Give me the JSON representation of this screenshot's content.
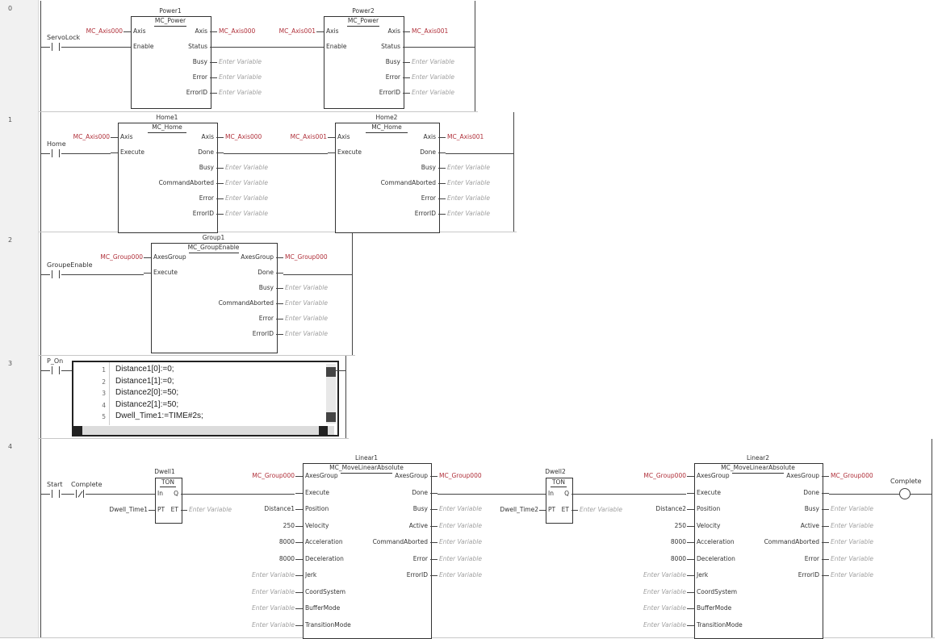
{
  "rungs": [
    {
      "number": "0",
      "contact": {
        "label": "ServoLock"
      },
      "blocks": [
        {
          "instance": "Power1",
          "type": "MC_Power",
          "axis_in": "MC_Axis000",
          "axis_out": "MC_Axis000",
          "inputs": [
            "Axis",
            "Enable"
          ],
          "outputs": [
            "Axis",
            "Status",
            "Busy",
            "Error",
            "ErrorID"
          ]
        },
        {
          "instance": "Power2",
          "type": "MC_Power",
          "axis_in": "MC_Axis001",
          "axis_out": "MC_Axis001",
          "inputs": [
            "Axis",
            "Enable"
          ],
          "outputs": [
            "Axis",
            "Status",
            "Busy",
            "Error",
            "ErrorID"
          ]
        }
      ]
    },
    {
      "number": "1",
      "contact": {
        "label": "Home"
      },
      "blocks": [
        {
          "instance": "Home1",
          "type": "MC_Home",
          "axis_in": "MC_Axis000",
          "axis_out": "MC_Axis000",
          "inputs": [
            "Axis",
            "Execute"
          ],
          "outputs": [
            "Axis",
            "Done",
            "Busy",
            "CommandAborted",
            "Error",
            "ErrorID"
          ]
        },
        {
          "instance": "Home2",
          "type": "MC_Home",
          "axis_in": "MC_Axis001",
          "axis_out": "MC_Axis001",
          "inputs": [
            "Axis",
            "Execute"
          ],
          "outputs": [
            "Axis",
            "Done",
            "Busy",
            "CommandAborted",
            "Error",
            "ErrorID"
          ]
        }
      ]
    },
    {
      "number": "2",
      "contact": {
        "label": "GroupeEnable"
      },
      "blocks": [
        {
          "instance": "Group1",
          "type": "MC_GroupEnable",
          "axis_in": "MC_Group000",
          "axis_out": "MC_Group000",
          "inputs": [
            "AxesGroup",
            "Execute"
          ],
          "outputs": [
            "AxesGroup",
            "Done",
            "Busy",
            "CommandAborted",
            "Error",
            "ErrorID"
          ]
        }
      ]
    },
    {
      "number": "3",
      "contact": {
        "label": "P_On"
      },
      "st_lines": [
        {
          "n": "1",
          "code": "Distance1[0]:=0;"
        },
        {
          "n": "2",
          "code": "Distance1[1]:=0;"
        },
        {
          "n": "3",
          "code": "Distance2[0]:=50;"
        },
        {
          "n": "4",
          "code": "Distance2[1]:=50;"
        },
        {
          "n": "5",
          "code": "Dwell_Time1:=TIME#2s;"
        }
      ]
    },
    {
      "number": "4",
      "contacts": [
        "Start",
        "Complete"
      ],
      "timers": [
        {
          "instance": "Dwell1",
          "type": "TON",
          "pin_in": "In",
          "pin_q": "Q",
          "pin_pt": "PT",
          "pin_et": "ET",
          "pt_value": "Dwell_Time1"
        },
        {
          "instance": "Dwell2",
          "type": "TON",
          "pin_in": "In",
          "pin_q": "Q",
          "pin_pt": "PT",
          "pin_et": "ET",
          "pt_value": "Dwell_Time2"
        }
      ],
      "moves": [
        {
          "instance": "Linear1",
          "type": "MC_MoveLinearAbsolute",
          "group_in": "MC_Group000",
          "group_out": "MC_Group000",
          "inputs": [
            "AxesGroup",
            "Execute",
            "Position",
            "Velocity",
            "Acceleration",
            "Deceleration",
            "Jerk",
            "CoordSystem",
            "BufferMode",
            "TransitionMode"
          ],
          "input_values": [
            "",
            "",
            "Distance1",
            "250",
            "8000",
            "8000",
            "Enter Variable",
            "Enter Variable",
            "Enter Variable",
            "Enter Variable"
          ],
          "outputs": [
            "AxesGroup",
            "Done",
            "Busy",
            "Active",
            "CommandAborted",
            "Error",
            "ErrorID"
          ]
        },
        {
          "instance": "Linear2",
          "type": "MC_MoveLinearAbsolute",
          "group_in": "MC_Group000",
          "group_out": "MC_Group000",
          "inputs": [
            "AxesGroup",
            "Execute",
            "Position",
            "Velocity",
            "Acceleration",
            "Deceleration",
            "Jerk",
            "CoordSystem",
            "BufferMode",
            "TransitionMode"
          ],
          "input_values": [
            "",
            "",
            "Distance2",
            "250",
            "8000",
            "8000",
            "Enter Variable",
            "Enter Variable",
            "Enter Variable",
            "Enter Variable"
          ],
          "outputs": [
            "AxesGroup",
            "Done",
            "Busy",
            "Active",
            "CommandAborted",
            "Error",
            "ErrorID"
          ]
        }
      ],
      "coil": {
        "label": "Complete"
      }
    }
  ],
  "placeholder": "Enter Variable"
}
